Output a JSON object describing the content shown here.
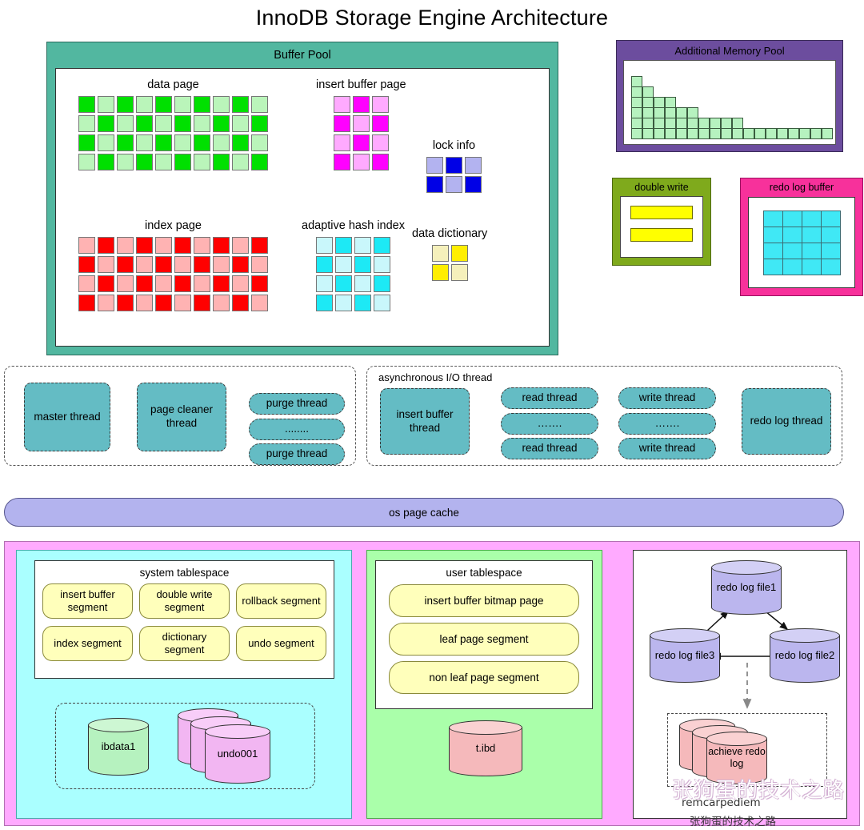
{
  "title": "InnoDB Storage Engine Architecture",
  "buffer_pool": {
    "title": "Buffer Pool",
    "blocks": [
      {
        "name": "data-page",
        "label": "data page",
        "cols": 10,
        "rows": 4,
        "colors": [
          "#00e000",
          "#baf5ba"
        ]
      },
      {
        "name": "insert-buffer-page",
        "label": "insert buffer page",
        "cols": 3,
        "rows": 4,
        "colors": [
          "#ffaaff",
          "#ff00ff"
        ]
      },
      {
        "name": "lock-info",
        "label": "lock info",
        "cols": 3,
        "rows": 2,
        "colors": [
          "#b3b3f0",
          "#0000e6"
        ]
      },
      {
        "name": "index-page",
        "label": "index page",
        "cols": 10,
        "rows": 4,
        "colors": [
          "#ffb3b3",
          "#ff0000"
        ]
      },
      {
        "name": "adaptive-hash-index",
        "label": "adaptive hash index",
        "cols": 4,
        "rows": 4,
        "colors": [
          "#c9f7fb",
          "#1de9f5"
        ]
      },
      {
        "name": "data-dictionary",
        "label": "data dictionary",
        "cols": 2,
        "rows": 2,
        "colors": [
          "#f5f0bb",
          "#ffee00"
        ]
      }
    ]
  },
  "additional_memory_pool": {
    "title": "Additional Memory Pool",
    "histogram": [
      6,
      5,
      4,
      4,
      3,
      3,
      2,
      2,
      2,
      2,
      1,
      1,
      1,
      1,
      1,
      1,
      1,
      1
    ],
    "cell_color": "#b6f2bf"
  },
  "double_write": {
    "title": "double write",
    "bars": 2,
    "bar_color": "#ffff00"
  },
  "redo_log_buffer": {
    "title": "redo log buffer",
    "cols": 4,
    "rows": 4,
    "cell_color": "#40e8f5"
  },
  "threads": {
    "left_group": {
      "master_thread": "master thread",
      "page_cleaner_thread": "page cleaner thread",
      "purge_threads": [
        "purge thread",
        "........",
        "purge thread"
      ]
    },
    "aio_group": {
      "title": "asynchronous I/O thread",
      "insert_buffer_thread": "insert buffer thread",
      "read_threads": [
        "read thread",
        "…….",
        "read thread"
      ],
      "write_threads": [
        "write thread",
        "…….",
        "write thread"
      ],
      "redo_log_thread": "redo log thread"
    },
    "color": "#64bcc4"
  },
  "os_page_cache": {
    "label": "os page cache",
    "color": "#b3b3ee"
  },
  "disk": {
    "system_tablespace": {
      "title": "system tablespace",
      "segments": [
        "insert buffer segment",
        "double write segment",
        "rollback segment",
        "index segment",
        "dictionary segment",
        "undo segment"
      ],
      "files": [
        {
          "name": "ibdata1",
          "label": "ibdata1",
          "color": "#b6f2bf",
          "stack": 1
        },
        {
          "name": "undo001",
          "label": "undo001",
          "color": "#f2b6f2",
          "stack": 3
        }
      ]
    },
    "user_tablespace": {
      "title": "user tablespace",
      "segments": [
        "insert buffer bitmap page",
        "leaf page segment",
        "non leaf page segment"
      ],
      "file": {
        "label": "t.ibd",
        "color": "#f5b9bb"
      }
    },
    "redo_logs": {
      "files": [
        {
          "label": "redo log file1",
          "color": "#bbb6ee"
        },
        {
          "label": "redo log file2",
          "color": "#bbb6ee"
        },
        {
          "label": "redo log file3",
          "color": "#bbb6ee"
        }
      ],
      "archive": {
        "label": "achieve redo log",
        "color": "#f5b9bb",
        "stack": 3
      }
    }
  },
  "watermark": {
    "overlay_text": "张狗蛋的技术之路",
    "account": "remcarpediem",
    "name": "张狗蛋的技术之路"
  }
}
